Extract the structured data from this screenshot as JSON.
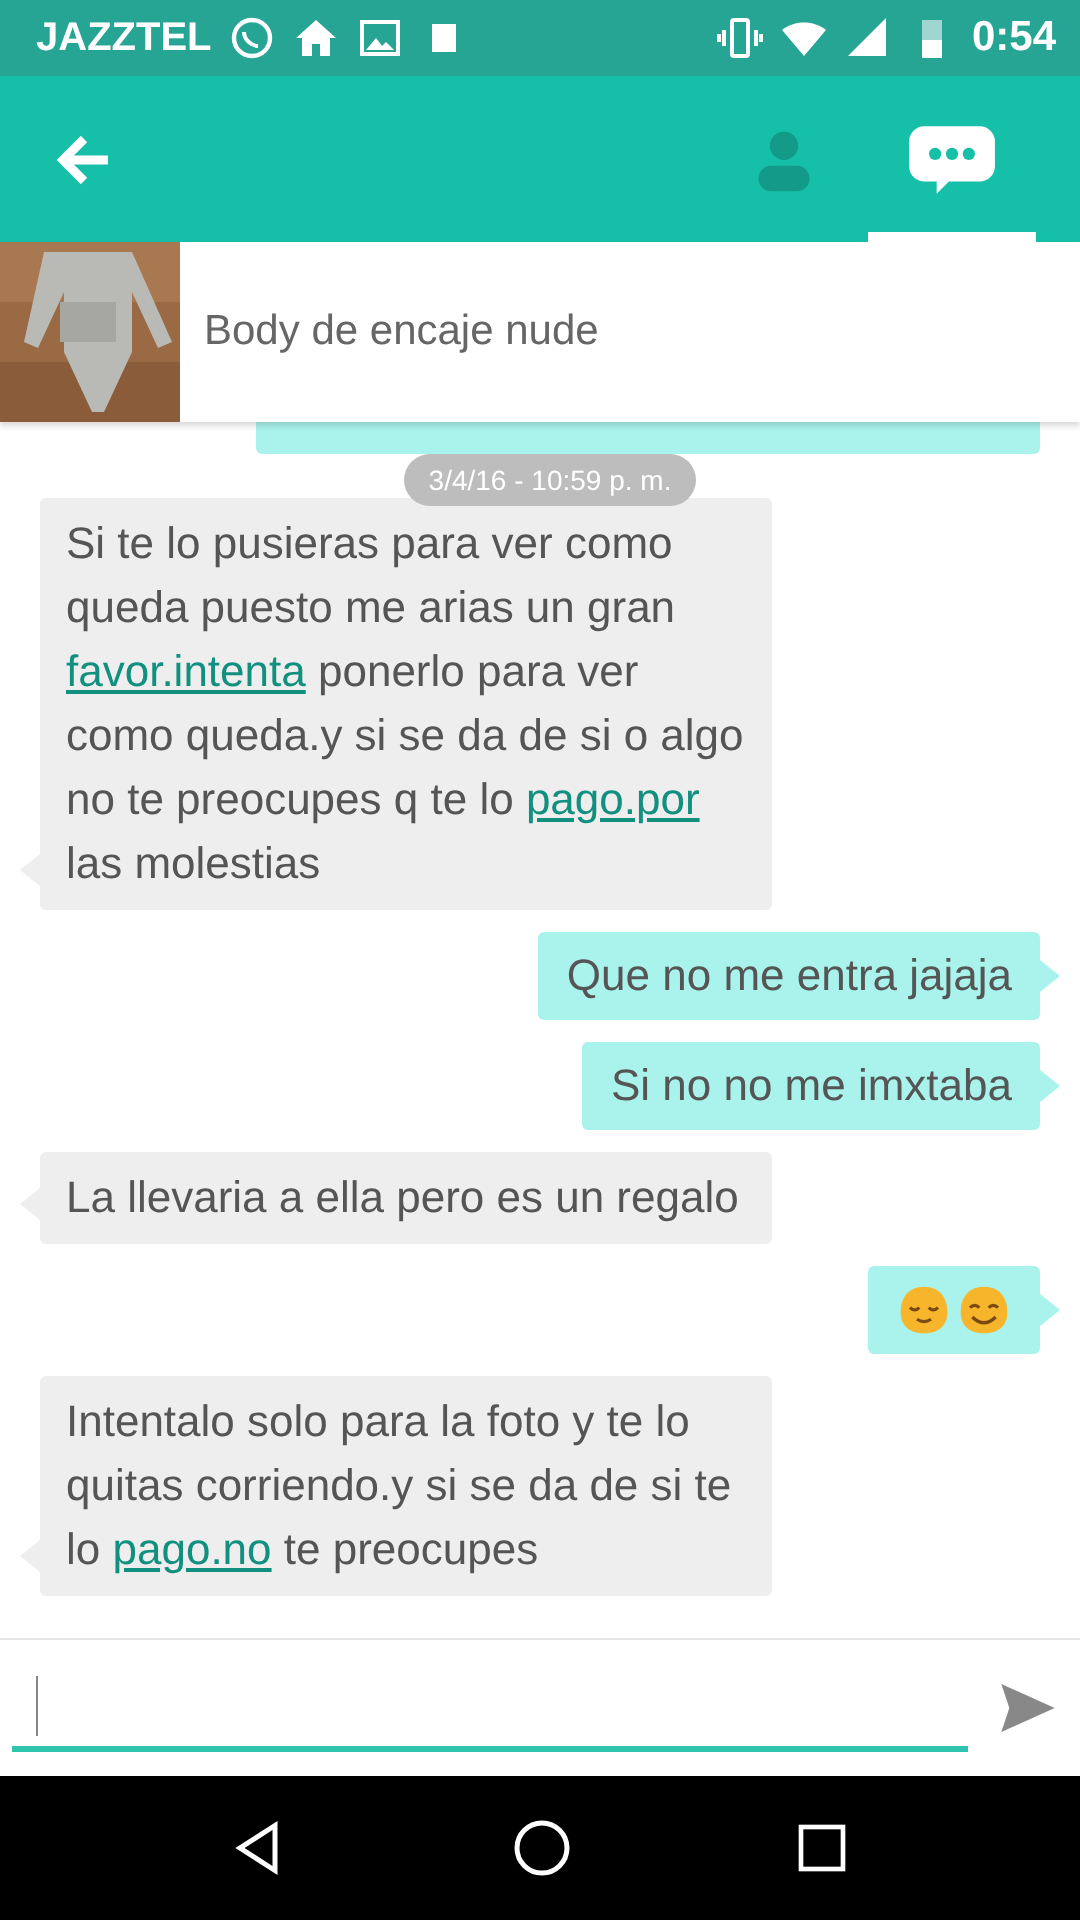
{
  "status_bar": {
    "carrier": "JAZZTEL",
    "time": "0:54"
  },
  "app_bar": {
    "tabs": [
      {
        "kind": "profile",
        "selected": false
      },
      {
        "kind": "chat",
        "selected": true
      }
    ]
  },
  "product": {
    "kind": "picture",
    "title": "Body de encaje nude"
  },
  "timestamp": "3/4/16 - 10:59 p. m.",
  "messages": [
    {
      "outgoing": false,
      "kind": "text",
      "parts": [
        {
          "kind": "text",
          "text": "Si te lo pusieras para ver como queda puesto me arias un gran "
        },
        {
          "kind": "link",
          "text": "favor.intenta"
        },
        {
          "kind": "text",
          "text": " ponerlo para ver como queda.y si se da de si o algo no te preocupes q te lo "
        },
        {
          "kind": "link",
          "text": "pago.por"
        },
        {
          "kind": "text",
          "text": " las molestias"
        }
      ]
    },
    {
      "outgoing": true,
      "kind": "text",
      "parts": [
        {
          "kind": "text",
          "text": "Que no me entra jajaja"
        }
      ]
    },
    {
      "outgoing": true,
      "kind": "text",
      "parts": [
        {
          "kind": "text",
          "text": "Si no no me imxtaba"
        }
      ]
    },
    {
      "outgoing": false,
      "kind": "text",
      "parts": [
        {
          "kind": "text",
          "text": "La llevaria a ella pero es un regalo"
        }
      ]
    },
    {
      "outgoing": true,
      "kind": "emoji"
    },
    {
      "outgoing": false,
      "kind": "text",
      "parts": [
        {
          "kind": "text",
          "text": "Intentalo solo para la foto y te lo quitas corriendo.y si se da de si te lo "
        },
        {
          "kind": "link",
          "text": "pago.no"
        },
        {
          "kind": "text",
          "text": " te preocupes"
        }
      ]
    }
  ]
}
